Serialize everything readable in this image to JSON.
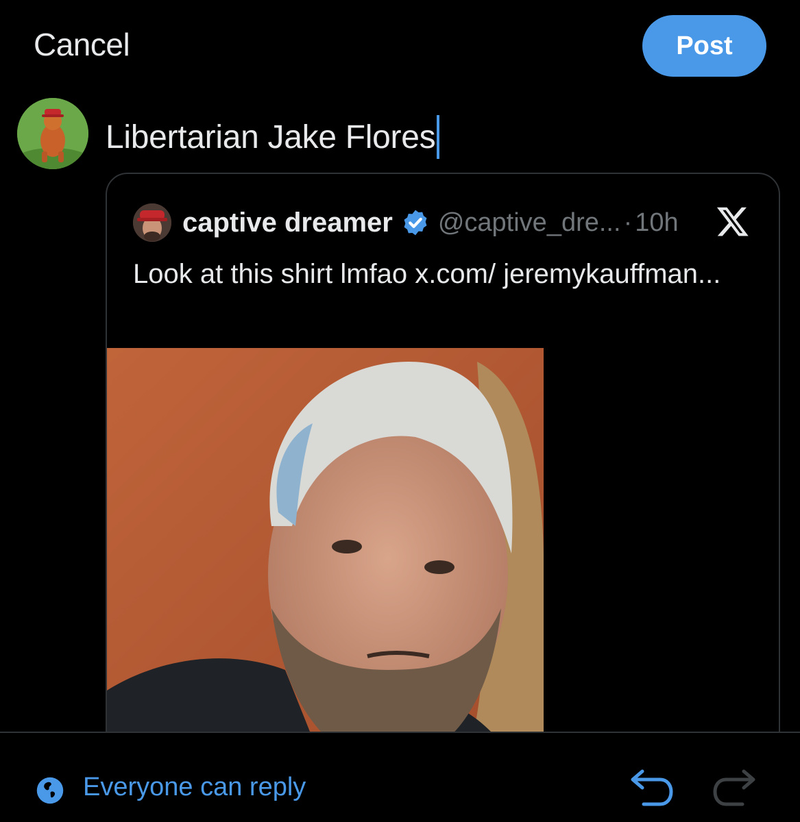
{
  "header": {
    "cancel_label": "Cancel",
    "post_label": "Post"
  },
  "compose": {
    "text": "Libertarian Jake Flores"
  },
  "quoted_post": {
    "author_name": "captive dreamer",
    "handle": "@captive_dre...",
    "separator": "·",
    "time": "10h",
    "text": "Look at this shirt lmfao x.com/ jeremykauffman...",
    "verified_icon": "verified-badge-icon",
    "brand_icon": "x-logo-icon"
  },
  "footer": {
    "reply_setting": "Everyone can reply",
    "icons": [
      "globe-icon",
      "undo-icon",
      "redo-icon"
    ]
  },
  "colors": {
    "accent": "#4a99e9",
    "background": "#000000",
    "text": "#e7e9ea",
    "muted": "#71767b",
    "border": "#2f3336"
  }
}
